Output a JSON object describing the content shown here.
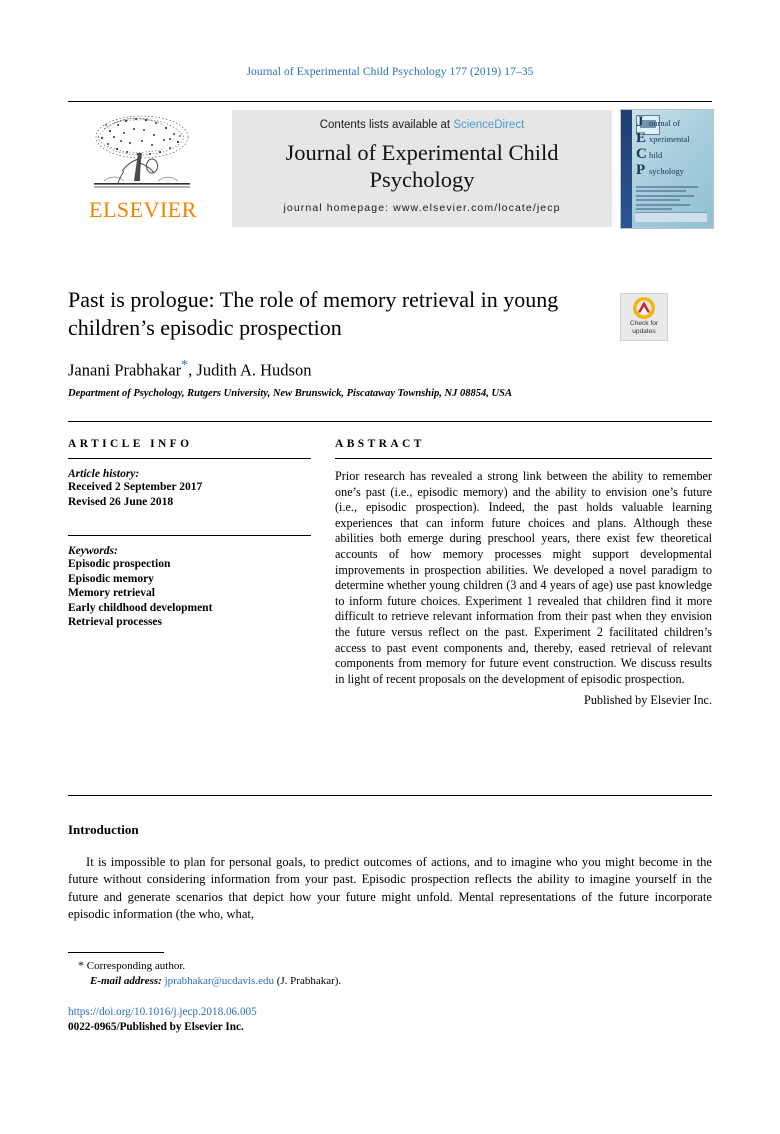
{
  "running_head": "Journal of Experimental Child Psychology 177 (2019) 17–35",
  "masthead": {
    "contents_prefix": "Contents lists available at ",
    "sciencedirect": "ScienceDirect",
    "journal_name": "Journal of Experimental Child Psychology",
    "homepage": "journal homepage: www.elsevier.com/locate/jecp",
    "publisher_wordmark": "ELSEVIER",
    "cover": {
      "letters": [
        "J",
        "E",
        "C",
        "P"
      ],
      "words": [
        "ournal of",
        "xperimental",
        "hild",
        "sychology"
      ]
    }
  },
  "article": {
    "title": "Past is prologue: The role of memory retrieval in young children’s episodic prospection",
    "authors": "Janani Prabhakar",
    "authors_star": "*",
    "authors_rest": ", Judith A. Hudson",
    "affiliation": "Department of Psychology, Rutgers University, New Brunswick, Piscataway Township, NJ 08854, USA"
  },
  "crossmark": {
    "line1": "Check for",
    "line2": "updates"
  },
  "info": {
    "heading": "ARTICLE INFO",
    "history_label": "Article history:",
    "received": "Received 2 September 2017",
    "revised": "Revised 26 June 2018",
    "keywords_label": "Keywords:",
    "keywords": [
      "Episodic prospection",
      "Episodic memory",
      "Memory retrieval",
      "Early childhood development",
      "Retrieval processes"
    ]
  },
  "abstract": {
    "heading": "ABSTRACT",
    "text": "Prior research has revealed a strong link between the ability to remember one’s past (i.e., episodic memory) and the ability to envision one’s future (i.e., episodic prospection). Indeed, the past holds valuable learning experiences that can inform future choices and plans. Although these abilities both emerge during preschool years, there exist few theoretical accounts of how memory processes might support developmental improvements in prospection abilities. We developed a novel paradigm to determine whether young children (3 and 4 years of age) use past knowledge to inform future choices. Experiment 1 revealed that children find it more difficult to retrieve relevant information from their past when they envision the future versus reflect on the past. Experiment 2 facilitated children’s access to past event components and, thereby, eased retrieval of relevant components from memory for future event construction. We discuss results in light of recent proposals on the development of episodic prospection.",
    "published_by": "Published by Elsevier Inc."
  },
  "body": {
    "intro_heading": "Introduction",
    "intro_paragraph": "It is impossible to plan for personal goals, to predict outcomes of actions, and to imagine who you might become in the future without considering information from your past. Episodic prospection reflects the ability to imagine yourself in the future and generate scenarios that depict how your future might unfold. Mental representations of the future incorporate episodic information (the who, what,"
  },
  "footnotes": {
    "corresponding": "Corresponding author.",
    "corresponding_star": "*",
    "email_label": "E-mail address:",
    "email": "jprabhakar@ucdavis.edu",
    "email_suffix": "(J. Prabhakar).",
    "doi": "https://doi.org/10.1016/j.jecp.2018.06.005",
    "issn_line": "0022-0965/Published by Elsevier Inc."
  },
  "colors": {
    "link_blue": "#2a6ebb",
    "sciencedirect_blue": "#4a9ad4",
    "elsevier_orange": "#ef8200"
  }
}
